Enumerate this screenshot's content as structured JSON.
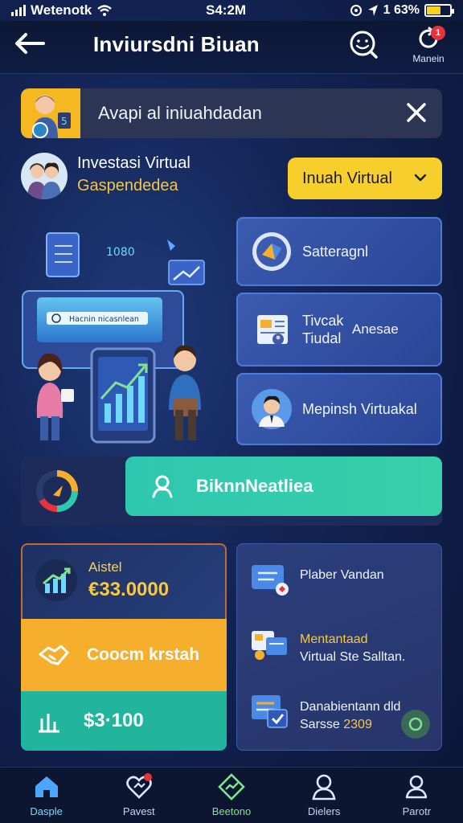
{
  "status_bar": {
    "carrier": "Wetenotk",
    "time": "S4:2M",
    "battery": "1 63%"
  },
  "header": {
    "title": "Inviursdni Biuan",
    "menu_label": "Manein",
    "notification_count": "1"
  },
  "alert": {
    "text": "Avapi al iniuahdadan"
  },
  "profile": {
    "name": "Investasi Virtual",
    "subtitle": "Gaspendedea",
    "dropdown_value": "Inuah Virtual"
  },
  "illustration": {
    "number": "1080",
    "screen_text": "Hacnin nicasnlean"
  },
  "feature_cards": [
    {
      "label": "Satteragnl"
    },
    {
      "label_line1": "Tivcak",
      "label_line2": "Tiudal",
      "label_right": "Anesae"
    },
    {
      "label": "Mepinsh Virtuakal"
    }
  ],
  "cta": {
    "label": "BiknnNeatliea"
  },
  "stats": {
    "total_label": "Aistel",
    "total_value": "€33.0000",
    "action_label": "Coocm krstah",
    "balance_value": "$3·100"
  },
  "info_list": [
    {
      "title": "Plaber Vandan"
    },
    {
      "title": "Mentantaad",
      "subtitle": "Virtual Ste Salltan."
    },
    {
      "title": "Danabientann dld",
      "subtitle_prefix": "Sarsse ",
      "subtitle_num": "2309"
    }
  ],
  "nav": [
    {
      "label": "Dasple"
    },
    {
      "label": "Pavest"
    },
    {
      "label": "Beetono"
    },
    {
      "label": "Dielers"
    },
    {
      "label": "Parotr"
    }
  ],
  "colors": {
    "accent_yellow": "#f7cf2c",
    "accent_teal": "#2ec7b0",
    "accent_orange": "#f6ae2d",
    "card_blue": "#3b5bb0",
    "background": "#132456"
  }
}
